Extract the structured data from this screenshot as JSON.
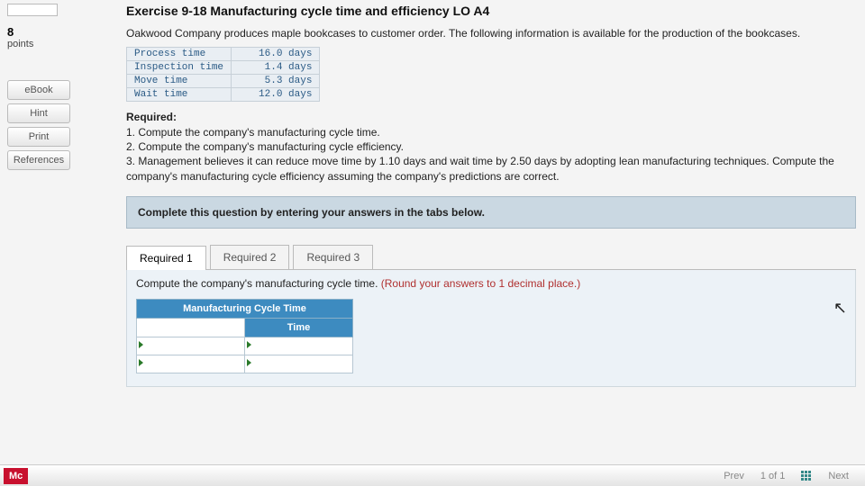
{
  "sidebar": {
    "points_value": "8",
    "points_label": "points",
    "links": [
      "eBook",
      "Hint",
      "Print",
      "References"
    ]
  },
  "title": "Exercise 9-18 Manufacturing cycle time and efficiency LO A4",
  "intro": "Oakwood Company produces maple bookcases to customer order. The following information is available for the production of the bookcases.",
  "data_rows": [
    {
      "label": "Process time",
      "value": "16.0 days"
    },
    {
      "label": "Inspection time",
      "value": "1.4 days"
    },
    {
      "label": "Move time",
      "value": "5.3 days"
    },
    {
      "label": "Wait time",
      "value": "12.0 days"
    }
  ],
  "required": {
    "heading": "Required:",
    "items": [
      "1. Compute the company's manufacturing cycle time.",
      "2. Compute the company's manufacturing cycle efficiency.",
      "3. Management believes it can reduce move time by 1.10 days and wait time by 2.50 days by adopting lean manufacturing techniques. Compute the company's manufacturing cycle efficiency assuming the company's predictions are correct."
    ]
  },
  "instruction_bar": "Complete this question by entering your answers in the tabs below.",
  "tabs": [
    "Required 1",
    "Required 2",
    "Required 3"
  ],
  "active_tab": 0,
  "tab_prompt": "Compute the company's manufacturing cycle time. ",
  "tab_note": "(Round your answers to 1 decimal place.)",
  "mct": {
    "header": "Manufacturing Cycle Time",
    "col": "Time"
  },
  "footer": {
    "brand": "Mc",
    "prev": "Prev",
    "pos": "1 of 1",
    "next": "Next"
  }
}
